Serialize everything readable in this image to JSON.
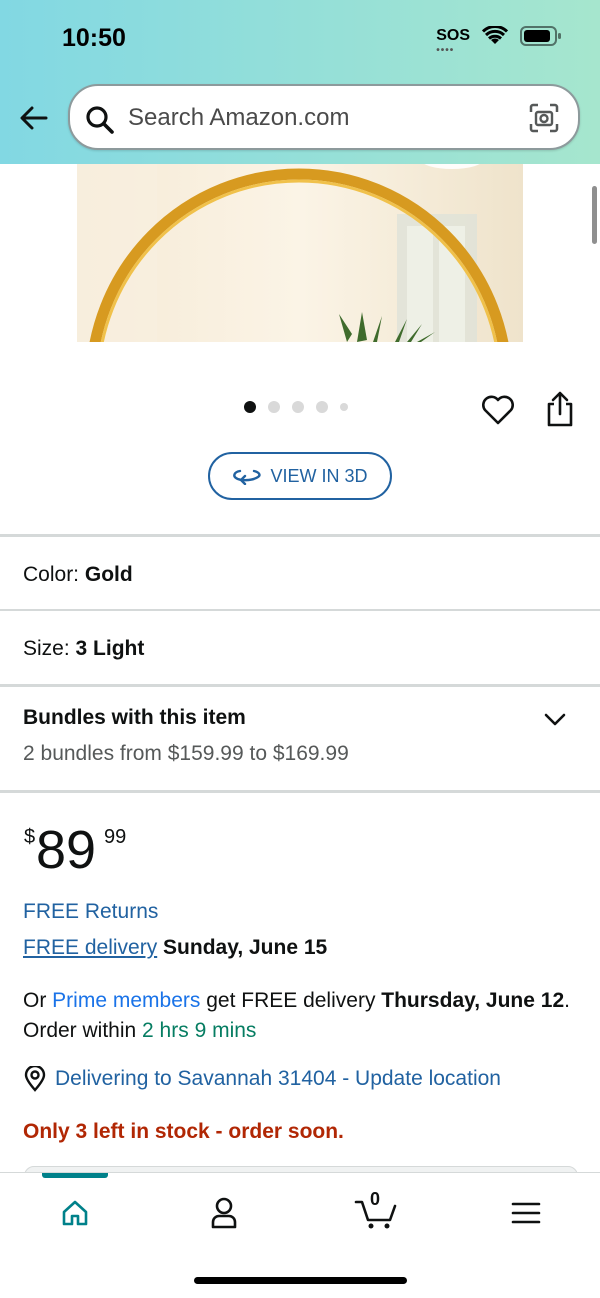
{
  "status_bar": {
    "time": "10:50",
    "sos": "SOS"
  },
  "search": {
    "placeholder": "Search Amazon.com"
  },
  "gallery": {
    "dot_count": 5,
    "active_index": 0
  },
  "view3d_label": "VIEW IN 3D",
  "options": {
    "color_label": "Color:",
    "color_value": "Gold",
    "size_label": "Size:",
    "size_value": "3 Light"
  },
  "bundles": {
    "title": "Bundles with this item",
    "subtitle": "2 bundles from $159.99 to $169.99"
  },
  "price": {
    "currency": "$",
    "whole": "89",
    "fraction": "99"
  },
  "delivery": {
    "free_returns": "FREE Returns",
    "free_delivery_link": "FREE delivery",
    "free_delivery_date": "Sunday, June 15",
    "prime_prefix": "Or ",
    "prime_link": "Prime members",
    "prime_mid": " get FREE delivery ",
    "prime_date": "Thursday, June 12",
    "order_within": ". Order within ",
    "countdown": "2 hrs 9 mins",
    "location": "Delivering to Savannah 31404 - Update location"
  },
  "stock": "Only 3 left in stock - order soon.",
  "tabbar": {
    "cart_count": "0",
    "active": "home"
  },
  "colors": {
    "accent_teal": "#00818a",
    "link": "#2162a1",
    "stock_red": "#b12704"
  }
}
